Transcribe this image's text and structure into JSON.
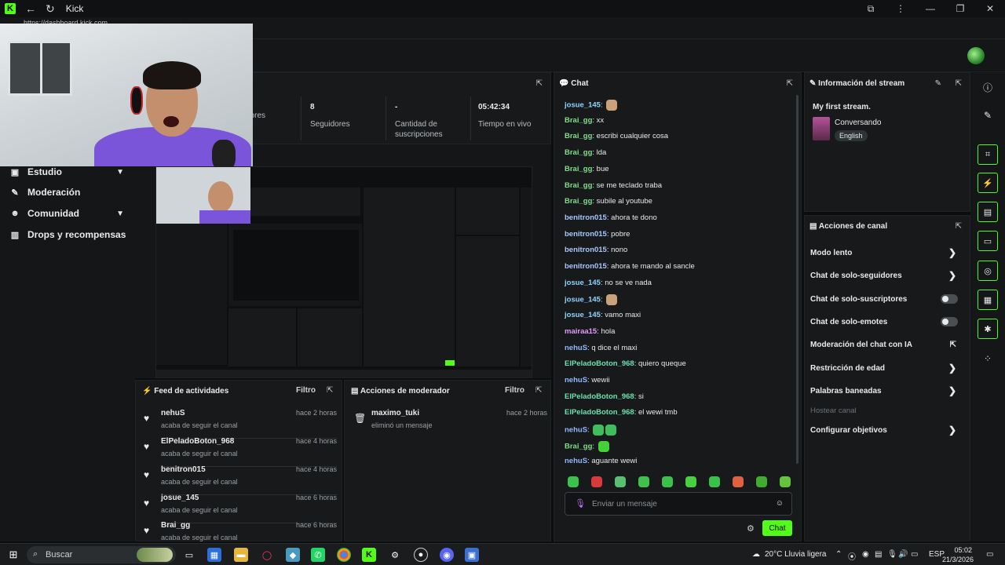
{
  "window": {
    "title": "Kick",
    "url": "https://dashboard.kick.com"
  },
  "sidebar": {
    "items": [
      {
        "label": "Estudio",
        "icon": "studio-icon",
        "has_chevron": true
      },
      {
        "label": "Moderación",
        "icon": "hammer-icon",
        "has_chevron": false
      },
      {
        "label": "Comunidad",
        "icon": "community-icon",
        "has_chevron": true
      },
      {
        "label": "Drops y recompensas",
        "icon": "drops-icon",
        "has_chevron": false
      }
    ]
  },
  "stats": {
    "items": [
      {
        "value": "",
        "label": "dores"
      },
      {
        "value": "8",
        "label": "Seguidores"
      },
      {
        "value": "-",
        "label": "Cantidad de suscripciones"
      },
      {
        "value": "05:42:34",
        "label": "Tiempo en vivo"
      }
    ]
  },
  "activity_feed": {
    "title": "Feed de actividades",
    "filter_label": "Filtro",
    "items": [
      {
        "name": "nehuS",
        "desc": "acaba de seguir el canal",
        "time": "hace 2 horas"
      },
      {
        "name": "ElPeladoBoton_968",
        "desc": "acaba de seguir el canal",
        "time": "hace 4 horas"
      },
      {
        "name": "benitron015",
        "desc": "acaba de seguir el canal",
        "time": "hace 4 horas"
      },
      {
        "name": "josue_145",
        "desc": "acaba de seguir el canal",
        "time": "hace 6 horas"
      },
      {
        "name": "Brai_gg",
        "desc": "acaba de seguir el canal",
        "time": "hace 6 horas"
      }
    ]
  },
  "mod_actions": {
    "title": "Acciones de moderador",
    "filter_label": "Filtro",
    "items": [
      {
        "name": "maximo_tuki",
        "desc": "eliminó un mensaje",
        "time": "hace 2 horas"
      }
    ]
  },
  "chat": {
    "title": "Chat",
    "messages": [
      {
        "user": "josue_145",
        "text": "",
        "color": "#8fd3ff",
        "emotes": [
          "#c9a27a"
        ]
      },
      {
        "user": "Brai_gg",
        "text": "xx",
        "color": "#7fe08a",
        "emotes": []
      },
      {
        "user": "Brai_gg",
        "text": "escribi cualquier cosa",
        "color": "#7fe08a",
        "emotes": []
      },
      {
        "user": "Brai_gg",
        "text": "lda",
        "color": "#7fe08a",
        "emotes": []
      },
      {
        "user": "Brai_gg",
        "text": "bue",
        "color": "#7fe08a",
        "emotes": []
      },
      {
        "user": "Brai_gg",
        "text": "se me teclado traba",
        "color": "#7fe08a",
        "emotes": []
      },
      {
        "user": "Brai_gg",
        "text": "subile al youtube",
        "color": "#7fe08a",
        "emotes": []
      },
      {
        "user": "benitron015",
        "text": "ahora te dono",
        "color": "#a9c7ff",
        "emotes": []
      },
      {
        "user": "benitron015",
        "text": "pobre",
        "color": "#a9c7ff",
        "emotes": []
      },
      {
        "user": "benitron015",
        "text": "nono",
        "color": "#a9c7ff",
        "emotes": []
      },
      {
        "user": "benitron015",
        "text": "ahora te mando al sancle",
        "color": "#a9c7ff",
        "emotes": []
      },
      {
        "user": "josue_145",
        "text": "no se ve nada",
        "color": "#8fd3ff",
        "emotes": []
      },
      {
        "user": "josue_145",
        "text": "",
        "color": "#8fd3ff",
        "emotes": [
          "#c9a27a"
        ]
      },
      {
        "user": "josue_145",
        "text": "vamo maxi",
        "color": "#8fd3ff",
        "emotes": []
      },
      {
        "user": "mairaa15",
        "text": "hola",
        "color": "#e39bff",
        "emotes": []
      },
      {
        "user": "nehuS",
        "text": "q dice el maxi",
        "color": "#8fb8ff",
        "emotes": []
      },
      {
        "user": "ElPeladoBoton_968",
        "text": "quiero queque",
        "color": "#6fe0b0",
        "emotes": []
      },
      {
        "user": "nehuS",
        "text": "wewii",
        "color": "#8fb8ff",
        "emotes": []
      },
      {
        "user": "ElPeladoBoton_968",
        "text": "si",
        "color": "#6fe0b0",
        "emotes": []
      },
      {
        "user": "ElPeladoBoton_968",
        "text": "el wewi tmb",
        "color": "#6fe0b0",
        "emotes": []
      },
      {
        "user": "nehuS",
        "text": "",
        "color": "#8fb8ff",
        "emotes": [
          "#3fbf5a",
          "#3fbf5a"
        ]
      },
      {
        "user": "Brai_gg",
        "text": "",
        "color": "#7fe08a",
        "emotes": [
          "#45d13a"
        ]
      },
      {
        "user": "nehuS",
        "text": "aguante wewi",
        "color": "#8fb8ff",
        "emotes": []
      }
    ],
    "emote_bar": [
      "#3ac24a",
      "#d93a3a",
      "#58c070",
      "#3ec24c",
      "#3ac24a",
      "#47d13a",
      "#38c24a",
      "#e06040",
      "#3fae30",
      "#64c43a"
    ],
    "input_placeholder": "Enviar un mensaje",
    "send_label": "Chat"
  },
  "stream_info": {
    "title": "Información del stream",
    "stream_title": "My first stream.",
    "category": "Conversando",
    "language": "English"
  },
  "channel_actions": {
    "title": "Acciones de canal",
    "items": [
      {
        "label": "Modo lento",
        "control": "chevron",
        "disabled": false
      },
      {
        "label": "Chat de solo-seguidores",
        "control": "chevron",
        "disabled": false
      },
      {
        "label": "Chat de solo-suscriptores",
        "control": "toggle",
        "disabled": false
      },
      {
        "label": "Chat de solo-emotes",
        "control": "toggle",
        "disabled": false
      },
      {
        "label": "Moderación del chat con IA",
        "control": "external",
        "disabled": false
      },
      {
        "label": "Restricción de edad",
        "control": "chevron",
        "disabled": false
      },
      {
        "label": "Palabras baneadas",
        "control": "chevron",
        "disabled": false
      },
      {
        "label": "Hostear canal",
        "control": "none",
        "disabled": true
      },
      {
        "label": "Configurar objetivos",
        "control": "chevron",
        "disabled": false
      }
    ]
  },
  "taskbar": {
    "search_placeholder": "Buscar",
    "weather": "20°C  Lluvia ligera",
    "language": "ESP",
    "time": "05:02",
    "date": "21/3/2026"
  },
  "colors": {
    "accent": "#53fc18",
    "panel": "#17191b",
    "background": "#0b0e0f"
  }
}
